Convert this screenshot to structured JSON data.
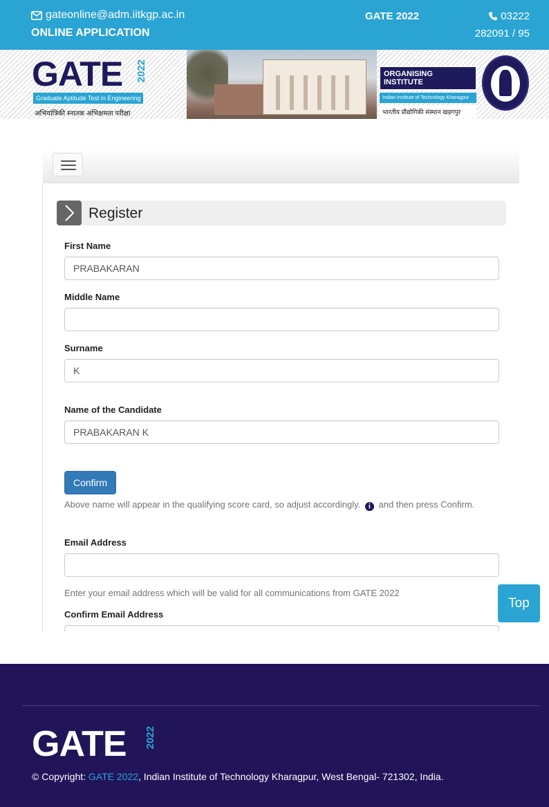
{
  "header": {
    "email": "gateonline@adm.iitkgp.ac.in",
    "online_application": "ONLINE APPLICATION",
    "title": "GATE 2022",
    "phone_line1": "03222",
    "phone_line2": "282091 / 95"
  },
  "banner": {
    "logo_text": "GATE",
    "logo_year": "2022",
    "logo_subtitle": "Graduate Aptitude Test in Engineering",
    "logo_hindi": "अभियांत्रिकी स्नातक अभिक्षमता परीक्षा",
    "organising_label": "ORGANISING INSTITUTE",
    "institute_name": "Indian Institute of Technology Kharagpur",
    "institute_hindi": "भारतीय प्रौद्योगिकी संस्थान खड़गपुर"
  },
  "form": {
    "heading": "Register",
    "first_name_label": "First Name",
    "first_name_value": "PRABAKARAN",
    "middle_name_label": "Middle Name",
    "middle_name_value": "",
    "surname_label": "Surname",
    "surname_value": "K",
    "candidate_label": "Name of the Candidate",
    "candidate_value": "PRABAKARAN K",
    "confirm_label": "Confirm",
    "name_help_part1": "Above name will appear in the qualifying score card, so adjust accordingly.",
    "name_help_part2": "and then press Confirm.",
    "email_label": "Email Address",
    "email_value": "",
    "email_help": "Enter your email address which will be valid for all communications from GATE 2022",
    "confirm_email_label": "Confirm Email Address",
    "confirm_email_value": ""
  },
  "top_button": "Top",
  "footer": {
    "logo_text": "GATE",
    "logo_year": "2022",
    "copyright_prefix": "© Copyright: ",
    "copyright_link": "GATE 2022",
    "copyright_suffix": ", Indian Institute of Technology Kharagpur, West Bengal- 721302, India."
  },
  "colors": {
    "topbar": "#2aa4d3",
    "footer": "#211459",
    "button": "#337ab7"
  }
}
